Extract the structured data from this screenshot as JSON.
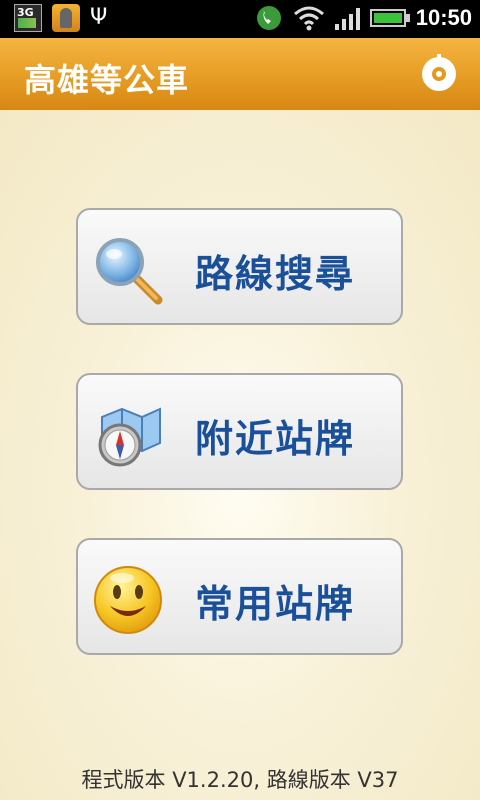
{
  "status_bar": {
    "network_label": "3G",
    "usb_glyph": "Ψ",
    "time": "10:50"
  },
  "app": {
    "title": "高雄等公車"
  },
  "menu": [
    {
      "label": "路線搜尋",
      "icon": "magnifier-icon"
    },
    {
      "label": "附近站牌",
      "icon": "map-compass-icon"
    },
    {
      "label": "常用站牌",
      "icon": "smiley-icon"
    }
  ],
  "footer": {
    "version_text": "程式版本 V1.2.20, 路線版本 V37"
  },
  "colors": {
    "titlebar": "#e49a22",
    "label": "#1a4f9a",
    "background": "#f3ecc9"
  }
}
